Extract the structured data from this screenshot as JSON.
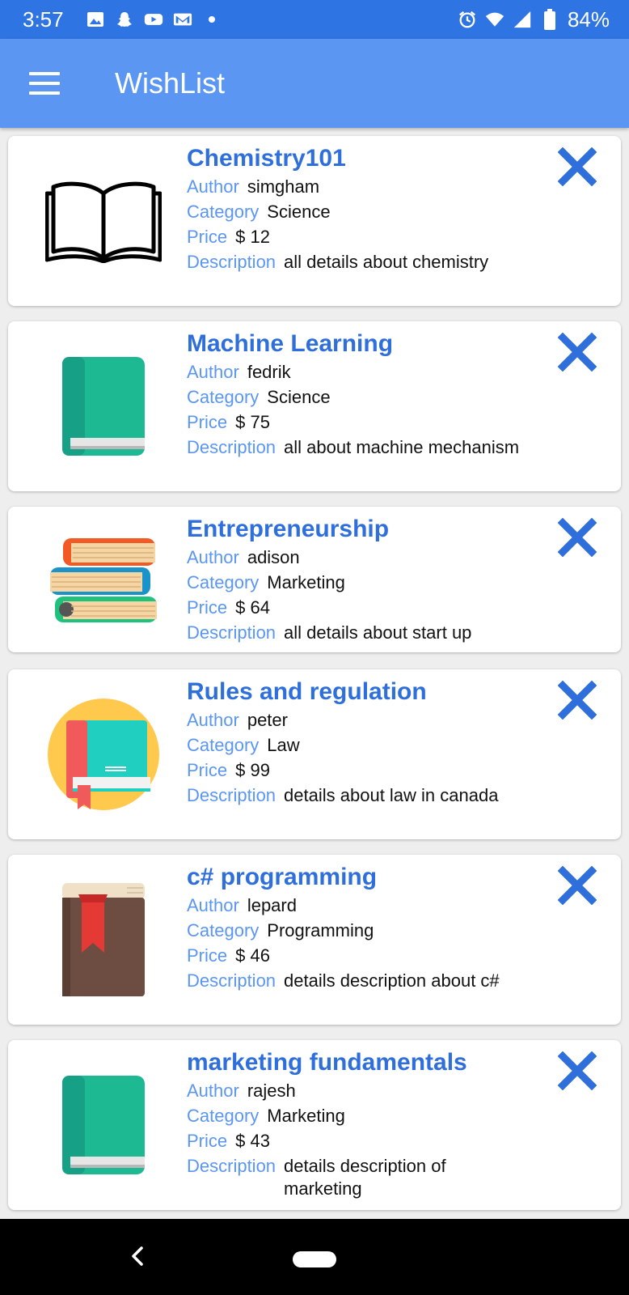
{
  "status_bar": {
    "time": "3:57",
    "left_icons": [
      "image-icon",
      "snapchat-icon",
      "youtube-icon",
      "gmail-icon",
      "dot-icon"
    ],
    "right_icons": [
      "alarm-icon",
      "wifi-icon",
      "signal-icon",
      "battery-icon"
    ],
    "battery": "84%"
  },
  "app_bar": {
    "title": "WishList",
    "menu_icon": "hamburger-menu-icon"
  },
  "labels": {
    "author": "Author",
    "category": "Category",
    "price": "Price",
    "description": "Description"
  },
  "colors": {
    "accent": "#2f6fdc",
    "label": "#5b96f3",
    "appbar": "#5b96f3",
    "statusbar": "#2f74e3"
  },
  "books": [
    {
      "title": "Chemistry101",
      "author": "simgham",
      "category": "Science",
      "price": "$ 12",
      "description": "all details about chemistry",
      "icon": "open-book-icon"
    },
    {
      "title": "Machine Learning",
      "author": "fedrik",
      "category": "Science",
      "price": "$ 75",
      "description": "all about machine mechanism",
      "icon": "green-book-icon"
    },
    {
      "title": "Entrepreneurship",
      "author": "adison",
      "category": "Marketing",
      "price": "$ 64",
      "description": "all details about start up",
      "icon": "book-stack-icon"
    },
    {
      "title": "Rules and regulation",
      "author": "peter",
      "category": "Law",
      "price": "$ 99",
      "description": "details about law in canada",
      "icon": "law-book-icon"
    },
    {
      "title": "c# programming",
      "author": "lepard",
      "category": "Programming",
      "price": "$ 46",
      "description": "details description about c#",
      "icon": "brown-book-icon"
    },
    {
      "title": "marketing fundamentals",
      "author": "rajesh",
      "category": "Marketing",
      "price": "$ 43",
      "description": "details description of marketing",
      "icon": "green-book-icon"
    }
  ],
  "nav_bar": {
    "back_icon": "back-icon",
    "home_icon": "home-pill-icon"
  }
}
